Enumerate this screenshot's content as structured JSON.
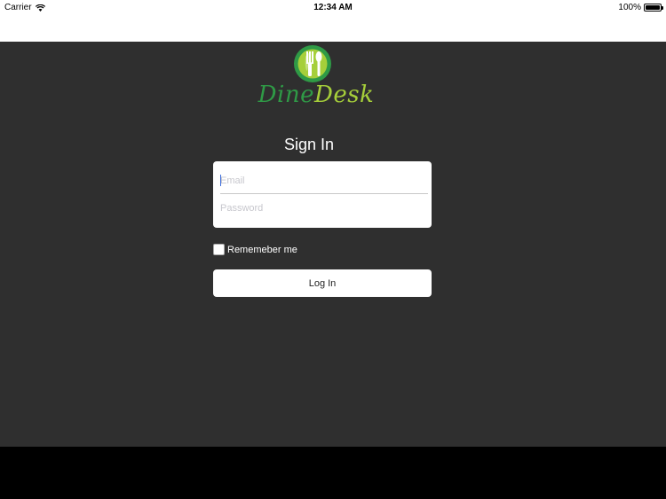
{
  "status_bar": {
    "carrier": "Carrier",
    "time": "12:34 AM",
    "battery": "100%"
  },
  "logo": {
    "part1": "Dine",
    "part2": "Desk"
  },
  "signin": {
    "title": "Sign In",
    "email_placeholder": "Email",
    "password_placeholder": "Password",
    "remember_label": "Rememeber me",
    "remember_checked": false,
    "login_label": "Log In"
  },
  "colors": {
    "background": "#2f2f2f",
    "logo_dark_green": "#2f9a46",
    "logo_light_green": "#a6cf3a"
  }
}
